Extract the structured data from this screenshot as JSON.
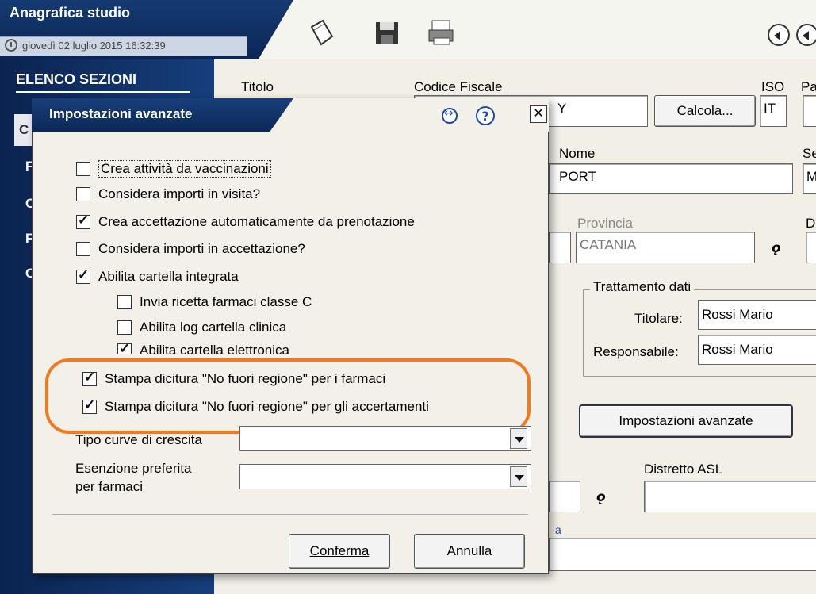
{
  "window": {
    "title": "Anagrafica studio",
    "datetime": "giovedì 02 luglio 2015   16:32:39"
  },
  "sidebar": {
    "title": "ELENCO SEZIONI",
    "items": [
      "C",
      "F",
      "C",
      "F",
      "C"
    ]
  },
  "form": {
    "titolo_label": "Titolo",
    "cf_label": "Codice Fiscale",
    "cf_value": "Y",
    "calcola_label": "Calcola...",
    "iso_label": "ISO",
    "iso_value": "IT",
    "pa_label": "Pa",
    "nome_label": "Nome",
    "nome_value": "PORT",
    "se_label": "Se",
    "se_value": "M",
    "provincia_label": "Provincia",
    "provincia_value": "CATANIA",
    "d_label": "D",
    "trattamento_title": "Trattamento dati",
    "titolare_label": "Titolare:",
    "titolare_value": "Rossi Mario",
    "responsabile_label": "Responsabile:",
    "responsabile_value": "Rossi Mario",
    "impostazioni_label": "Impostazioni avanzate",
    "distretto_label": "Distretto ASL",
    "partial_label": "a"
  },
  "dialog": {
    "title": "Impostazioni avanzate",
    "checkboxes": [
      {
        "label": "Crea attività da vaccinazioni",
        "checked": false
      },
      {
        "label": "Considera importi in visita?",
        "checked": false
      },
      {
        "label": "Crea accettazione automaticamente da prenotazione",
        "checked": true
      },
      {
        "label": "Considera importi in accettazione?",
        "checked": false
      },
      {
        "label": "Abilita cartella integrata",
        "checked": true
      },
      {
        "label": "Invia ricetta farmaci classe C",
        "checked": false
      },
      {
        "label": "Abilita log cartella clinica",
        "checked": false
      },
      {
        "label": "Abilita cartella elettronica",
        "checked": true
      },
      {
        "label": "Stampa dicitura \"No fuori regione\" per i farmaci",
        "checked": true
      },
      {
        "label": "Stampa dicitura \"No fuori regione\" per gli accertamenti",
        "checked": true
      }
    ],
    "tipo_curve_label": "Tipo curve di crescita",
    "esenzione_label_1": "Esenzione preferita",
    "esenzione_label_2": "per farmaci",
    "conferma_label": "Conferma",
    "annulla_label": "Annulla"
  },
  "colors": {
    "navy": "#0c2655",
    "highlight": "#f07a24"
  }
}
